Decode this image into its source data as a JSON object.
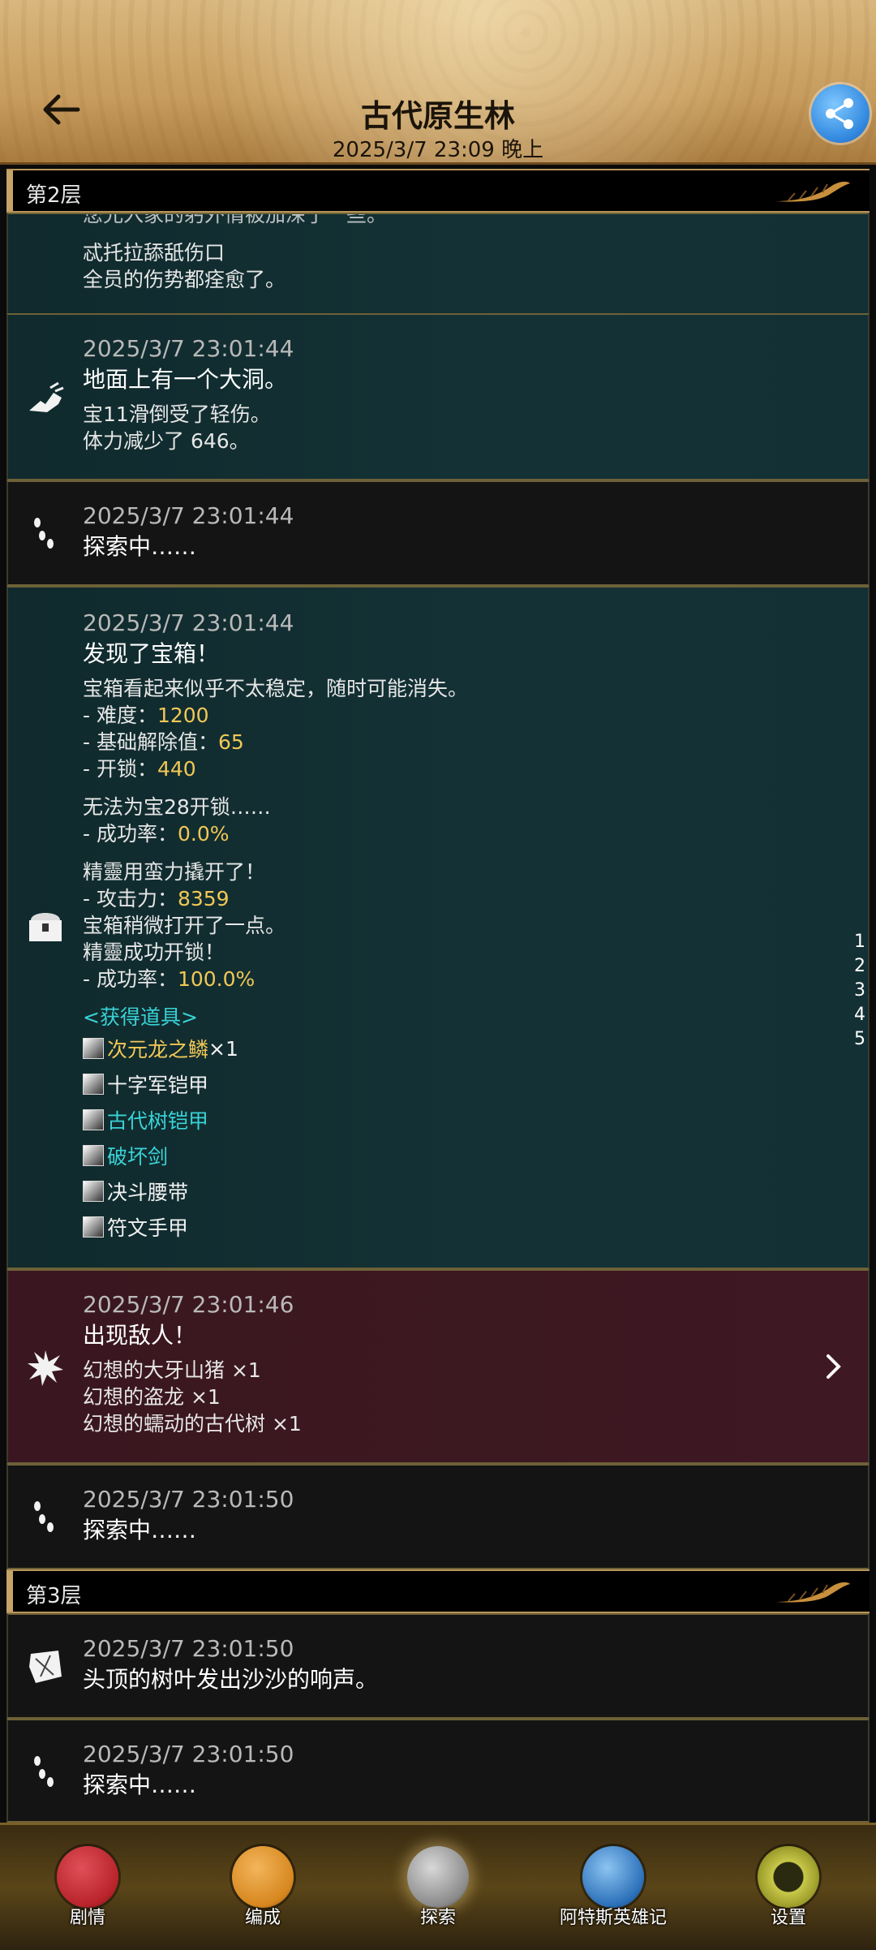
{
  "header": {
    "title": "古代原生林",
    "subtitle": "2025/3/7 23:09 晚上"
  },
  "layers": {
    "l2": "第2层",
    "l3": "第3层"
  },
  "entries": {
    "e0": {
      "cut_line": "您允入家的躬外情被加深了一些。",
      "lines": [
        "忒托拉舔舐伤口",
        "全员的伤势都痊愈了。"
      ]
    },
    "e1": {
      "time": "2025/3/7 23:01:44",
      "title": "地面上有一个大洞。",
      "lines": [
        "宝11滑倒受了轻伤。",
        "体力减少了 646。"
      ],
      "icon": "pit-icon"
    },
    "e2": {
      "time": "2025/3/7 23:01:44",
      "title": "探索中……",
      "icon": "footprints-icon"
    },
    "e3": {
      "time": "2025/3/7 23:01:44",
      "title": "发现了宝箱！",
      "icon": "treasure-chest-icon",
      "desc": "宝箱看起来似乎不太稳定，随时可能消失。",
      "stats": [
        {
          "label": "- 难度：",
          "value": "1200"
        },
        {
          "label": "- 基础解除值：",
          "value": "65"
        },
        {
          "label": "- 开锁：",
          "value": "440"
        }
      ],
      "fail_line": "无法为宝28开锁……",
      "fail_rate_label": "- 成功率：",
      "fail_rate_value": "0.0%",
      "force_line": "精靈用蛮力撬开了！",
      "attack_label": "- 攻击力：",
      "attack_value": "8359",
      "open_line1": "宝箱稍微打开了一点。",
      "open_line2": "精靈成功开锁！",
      "success_label": "- 成功率：",
      "success_value": "100.0%",
      "items_header": "<获得道具>",
      "items": [
        {
          "name": "次元龙之鳞",
          "suffix": "×1",
          "color": "gold",
          "icon": "dragon-scale-icon"
        },
        {
          "name": "十字军铠甲",
          "suffix": "",
          "color": "white",
          "icon": "crusader-armor-icon"
        },
        {
          "name": "古代树铠甲",
          "suffix": "",
          "color": "cyan",
          "icon": "ancient-tree-armor-icon"
        },
        {
          "name": "破坏剑",
          "suffix": "",
          "color": "cyan",
          "icon": "destruction-sword-icon"
        },
        {
          "name": "决斗腰带",
          "suffix": "",
          "color": "white",
          "icon": "duel-belt-icon"
        },
        {
          "name": "符文手甲",
          "suffix": "",
          "color": "white",
          "icon": "rune-gauntlet-icon"
        }
      ]
    },
    "e4": {
      "time": "2025/3/7 23:01:46",
      "title": "出现敌人！",
      "lines": [
        "幻想的大牙山猪 ×1",
        "幻想的盗龙 ×1",
        "幻想的蠕动的古代树 ×1"
      ],
      "icon": "enemy-burst-icon"
    },
    "e5": {
      "time": "2025/3/7 23:01:50",
      "title": "探索中……",
      "icon": "footprints-icon"
    },
    "e6": {
      "time": "2025/3/7 23:01:50",
      "title": "头顶的树叶发出沙沙的响声。",
      "icon": "leaves-icon"
    },
    "e7": {
      "time": "2025/3/7 23:01:50",
      "title": "探索中……",
      "icon": "footprints-icon"
    }
  },
  "page_index": [
    "1",
    "2",
    "3",
    "4",
    "5"
  ],
  "nav": [
    {
      "label": "剧情",
      "icon": "story-dragon-icon",
      "color": "#b8232a"
    },
    {
      "label": "编成",
      "icon": "formation-crest-icon",
      "color": "#d6861e"
    },
    {
      "label": "探索",
      "icon": "explore-map-icon",
      "color": "#8a8a8a"
    },
    {
      "label": "阿特斯英雄记",
      "icon": "hero-scroll-icon",
      "color": "#2a6fb8"
    },
    {
      "label": "设置",
      "icon": "settings-gear-icon",
      "color": "#9a9a2a"
    }
  ],
  "colors": {
    "accent_gold": "#f1c856",
    "accent_cyan": "#38d3d6",
    "entry_teal": "#133034",
    "entry_maroon": "#3e1822"
  }
}
